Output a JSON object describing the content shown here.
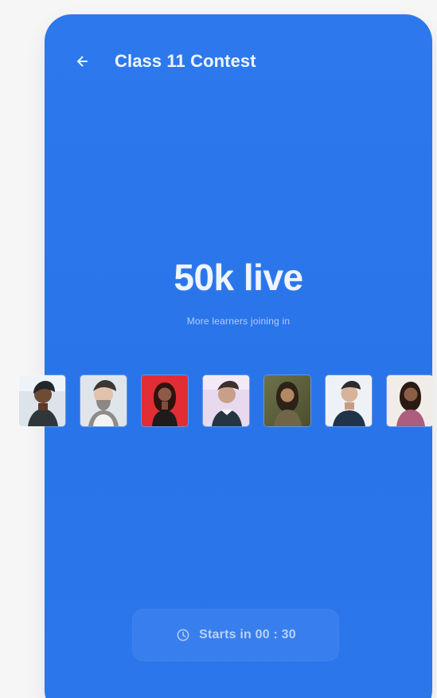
{
  "header": {
    "back_icon": "arrow-left-icon",
    "title": "Class 11 Contest"
  },
  "hero": {
    "count": "50k live",
    "subtitle": "More learners joining in"
  },
  "avatars": [
    {
      "name": "avatar-1"
    },
    {
      "name": "avatar-2"
    },
    {
      "name": "avatar-3"
    },
    {
      "name": "avatar-4"
    },
    {
      "name": "avatar-5"
    },
    {
      "name": "avatar-6"
    },
    {
      "name": "avatar-7"
    }
  ],
  "cta": {
    "icon": "clock-icon",
    "label": "Starts in 00 : 30"
  },
  "colors": {
    "background": "#f6f6f6",
    "primary": "#2b76eb",
    "text": "#eef5ff"
  }
}
